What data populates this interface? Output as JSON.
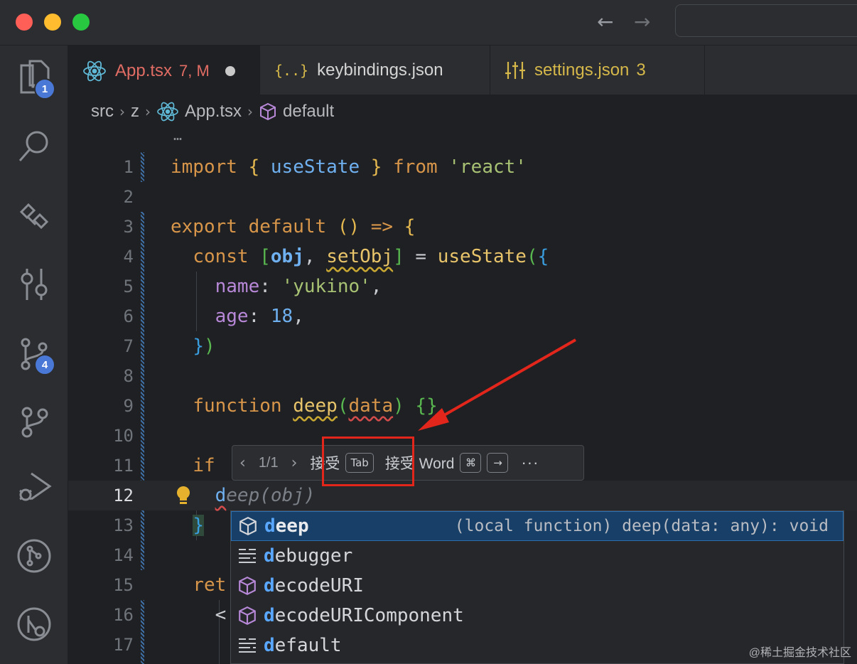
{
  "tabs": [
    {
      "label": "App.tsx",
      "status": "7, M",
      "active": true
    },
    {
      "label": "keybindings.json",
      "icon_text": "{..}"
    },
    {
      "label": "settings.json",
      "count": "3"
    }
  ],
  "breadcrumb": [
    "src",
    "z",
    "App.tsx",
    "default"
  ],
  "fold_marker": "…",
  "activity_badges": {
    "explorer": "1",
    "source_control": "4"
  },
  "code": {
    "line_numbers": [
      "1",
      "2",
      "3",
      "4",
      "5",
      "6",
      "7",
      "8",
      "9",
      "10",
      "11",
      "12",
      "13",
      "14",
      "15",
      "16",
      "17"
    ],
    "current_line": "12",
    "l1": {
      "kw1": "import",
      "b1": "{",
      "id": "useState",
      "b2": "}",
      "kw2": "from",
      "str": "'react'"
    },
    "l3": {
      "kw1": "export",
      "kw2": "default",
      "p": "()",
      "arrow": "=>",
      "b": "{"
    },
    "l4": {
      "kw": "const",
      "b1": "[",
      "v1": "obj",
      "c": ",",
      "v2": "setObj",
      "b2": "]",
      "eq": "=",
      "fn": "useState",
      "p": "(",
      "b": "{"
    },
    "l5": {
      "prop": "name",
      "c": ":",
      "str": "'yukino'",
      "comma": ","
    },
    "l6": {
      "prop": "age",
      "c": ":",
      "num": "18",
      "comma": ","
    },
    "l7": {
      "b": "}",
      "p": ")"
    },
    "l9": {
      "kw": "function",
      "fn": "deep",
      "p1": "(",
      "arg": "data",
      "p2": ")",
      "b": "{}"
    },
    "l11": {
      "kw": "if"
    },
    "l12": {
      "typed": "d",
      "ghost": "eep(obj)"
    },
    "l13": {
      "b": "}"
    },
    "l15": {
      "kw": "ret"
    },
    "l16": {
      "tag": "<"
    }
  },
  "inline_toolbar": {
    "count": "1/1",
    "accept": "接受",
    "accept_key": "Tab",
    "accept_word": "接受 Word",
    "cmd_key": "⌘",
    "arrow_key": "→",
    "more": "···"
  },
  "suggestions": [
    {
      "match": "d",
      "rest": "eep",
      "detail": "(local function) deep(data: any): void",
      "icon": "cube-icon",
      "selected": true
    },
    {
      "match": "d",
      "rest": "ebugger",
      "detail": "",
      "icon": "snippet-icon"
    },
    {
      "match": "d",
      "rest": "ecodeURI",
      "detail": "",
      "icon": "cube-purple-icon"
    },
    {
      "match": "d",
      "rest": "ecodeURIComponent",
      "detail": "",
      "icon": "cube-purple-icon"
    },
    {
      "match": "d",
      "rest": "efault",
      "detail": "",
      "icon": "snippet-icon"
    }
  ],
  "watermark": "@稀土掘金技术社区",
  "colors": {
    "accent": "#4a78d6",
    "selection": "#173f67",
    "annotation": "#e3261c"
  }
}
